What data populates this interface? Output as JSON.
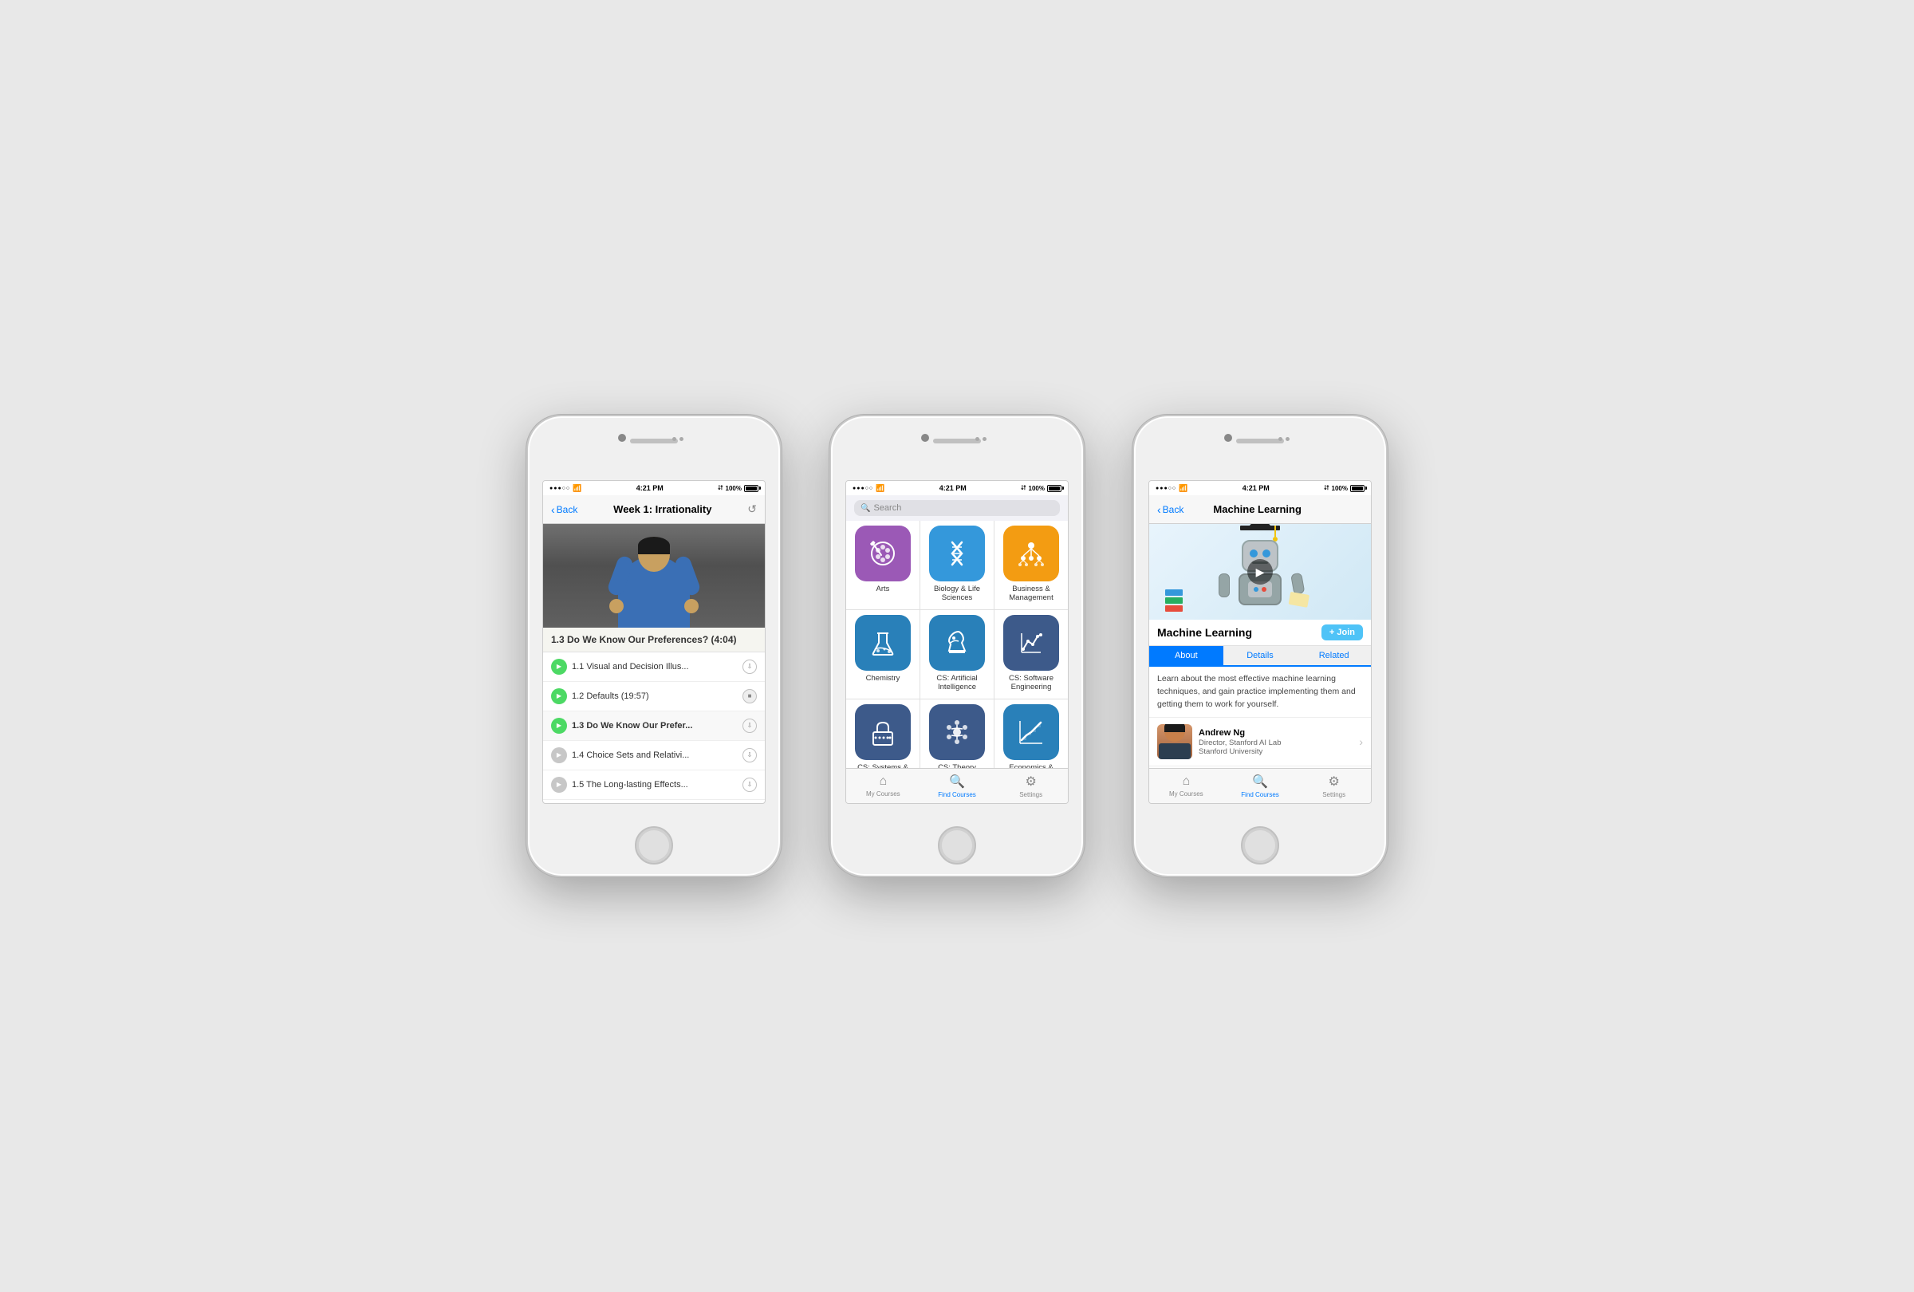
{
  "phones": [
    {
      "id": "phone1",
      "statusBar": {
        "time": "4:21 PM",
        "signal": "●●●○○",
        "wifi": true,
        "bluetooth": true,
        "battery": "100%"
      },
      "nav": {
        "backLabel": "Back",
        "title": "Week 1: Irrationality"
      },
      "currentLesson": {
        "title": "1.3 Do We Know Our Preferences? (4:04)"
      },
      "lessons": [
        {
          "id": "l1",
          "number": "1.1",
          "title": "Visual and Decision Illus...",
          "status": "green",
          "downloaded": false
        },
        {
          "id": "l2",
          "number": "1.2",
          "title": "Defaults (19:57)",
          "status": "green",
          "downloaded": true
        },
        {
          "id": "l3",
          "number": "1.3",
          "title": "Do We Know Our Prefe...",
          "status": "green",
          "active": true,
          "downloaded": false
        },
        {
          "id": "l4",
          "number": "1.4",
          "title": "Choice Sets and Relativi...",
          "status": "gray",
          "downloaded": false
        },
        {
          "id": "l5",
          "number": "1.5",
          "title": "The Long-lasting Effects...",
          "status": "gray",
          "downloaded": false
        }
      ]
    },
    {
      "id": "phone2",
      "statusBar": {
        "time": "4:21 PM",
        "signal": "●●●○○",
        "wifi": true,
        "bluetooth": true,
        "battery": "100%"
      },
      "searchPlaceholder": "Search",
      "categories": [
        {
          "id": "arts",
          "label": "Arts",
          "color": "#9b59b6",
          "icon": "arts"
        },
        {
          "id": "biology",
          "label": "Biology & Life Sciences",
          "color": "#3498db",
          "icon": "biology"
        },
        {
          "id": "business",
          "label": "Business & Management",
          "color": "#f39c12",
          "icon": "business"
        },
        {
          "id": "chemistry",
          "label": "Chemistry",
          "color": "#2980b9",
          "icon": "chemistry"
        },
        {
          "id": "cs-ai",
          "label": "CS: Artificial Intelligence",
          "color": "#2980b9",
          "icon": "cs-ai"
        },
        {
          "id": "cs-se",
          "label": "CS: Software Engineering",
          "color": "#3d5a8a",
          "icon": "cs-se"
        },
        {
          "id": "cs-sec",
          "label": "CS: Systems & Security",
          "color": "#3d5a8a",
          "icon": "cs-sec"
        },
        {
          "id": "cs-theory",
          "label": "CS: Theory",
          "color": "#3d5a8a",
          "icon": "cs-theory"
        },
        {
          "id": "econ",
          "label": "Economics & Finance",
          "color": "#2980b9",
          "icon": "econ"
        }
      ],
      "tabBar": {
        "tabs": [
          {
            "id": "my-courses",
            "label": "My Courses",
            "icon": "home",
            "active": false
          },
          {
            "id": "find-courses",
            "label": "Find Courses",
            "icon": "search",
            "active": true
          },
          {
            "id": "settings",
            "label": "Settings",
            "icon": "gear",
            "active": false
          }
        ]
      }
    },
    {
      "id": "phone3",
      "statusBar": {
        "time": "4:21 PM",
        "signal": "●●●○○",
        "wifi": true,
        "bluetooth": true,
        "battery": "100%"
      },
      "nav": {
        "backLabel": "Back",
        "title": "Machine Learning"
      },
      "course": {
        "title": "Machine Learning",
        "joinLabel": "+ Join",
        "description": "Learn about the most effective machine learning techniques, and gain practice implementing them and getting them to work for yourself.",
        "tabs": [
          {
            "id": "about",
            "label": "About",
            "active": true
          },
          {
            "id": "details",
            "label": "Details",
            "active": false
          },
          {
            "id": "related",
            "label": "Related",
            "active": false
          }
        ],
        "instructor": {
          "name": "Andrew Ng",
          "title": "Director, Stanford AI Lab",
          "university": "Stanford University"
        }
      },
      "tabBar": {
        "tabs": [
          {
            "id": "my-courses",
            "label": "My Courses",
            "icon": "home",
            "active": false
          },
          {
            "id": "find-courses",
            "label": "Find Courses",
            "icon": "search",
            "active": true
          },
          {
            "id": "settings",
            "label": "Settings",
            "icon": "gear",
            "active": false
          }
        ]
      }
    }
  ]
}
